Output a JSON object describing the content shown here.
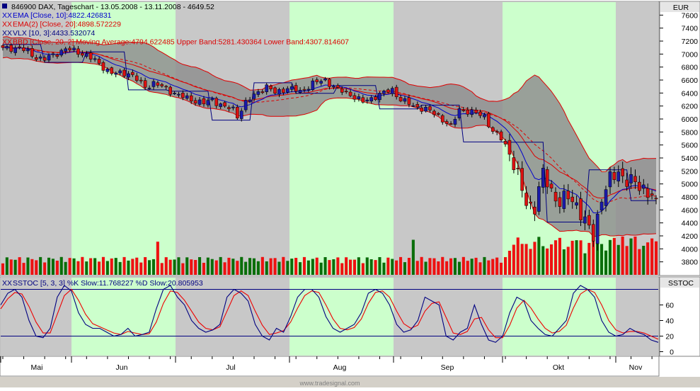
{
  "header": {
    "symbol_title": "846900 DAX, Tageschart - 13.05.2008 - 13.11.2008 - 4649.52",
    "currency": "EUR",
    "lower_panel_label": "SSTOC",
    "footer": "www.tradesignal.com"
  },
  "legend_upper": [
    {
      "text": "EMA [Close, 10]:4822.426831",
      "color": "#0000cc"
    },
    {
      "text": "EMA(2) [Close, 20]:4898.572229",
      "color": "#dd0000"
    },
    {
      "text": "VLX [10, 3]:4433.532074",
      "color": "#000080"
    },
    {
      "text": "BBD [Close, 20, 2] Moving Average:4794.622485 Upper Band:5281.430364 Lower Band:4307.814607",
      "color": "#dd0000"
    }
  ],
  "legend_lower": [
    {
      "text": "SSTOC [5, 3, 3] %K Slow:11.768227 %D Slow:20.805953",
      "color": "#000080"
    }
  ],
  "colors": {
    "up_candle": "#1a1aaa",
    "down_candle": "#dd1111",
    "volume_up": "#0a6e0a",
    "volume_down": "#ee1111",
    "band_fill": "#8f8f8f",
    "band_line": "#dd0000",
    "ema10": "#0000cc",
    "ema20": "#dd0000",
    "vlx": "#000080",
    "stoch_k": "#000080",
    "stoch_d": "#ee0000",
    "month_shade_green": "#ccffcc",
    "month_shade_grey": "#c8c8c8"
  },
  "chart_data": [
    {
      "type": "candlestick",
      "title": "846900 DAX, Tageschart - 13.05.2008 - 13.11.2008 - 4649.52",
      "ylabel": "EUR",
      "ylim": [
        3600,
        7800
      ],
      "yticks": [
        3800,
        4000,
        4200,
        4400,
        4600,
        4800,
        5000,
        5200,
        5400,
        5600,
        5800,
        6000,
        6200,
        6400,
        6600,
        6800,
        7000,
        7200,
        7400,
        7600
      ],
      "months": [
        "Mai",
        "Jun",
        "Jul",
        "Aug",
        "Sep",
        "Okt",
        "Nov"
      ],
      "anchors": [
        [
          0,
          7080
        ],
        [
          4,
          7100
        ],
        [
          8,
          6950
        ],
        [
          10,
          6920
        ],
        [
          15,
          7080
        ],
        [
          18,
          7030
        ],
        [
          20,
          6980
        ],
        [
          23,
          6850
        ],
        [
          26,
          6700
        ],
        [
          30,
          6710
        ],
        [
          34,
          6500
        ],
        [
          36,
          6550
        ],
        [
          39,
          6470
        ],
        [
          42,
          6360
        ],
        [
          45,
          6300
        ],
        [
          48,
          6240
        ],
        [
          50,
          6300
        ],
        [
          53,
          6180
        ],
        [
          55,
          6150
        ],
        [
          56,
          6050
        ],
        [
          58,
          6250
        ],
        [
          61,
          6420
        ],
        [
          63,
          6500
        ],
        [
          65,
          6400
        ],
        [
          68,
          6480
        ],
        [
          71,
          6420
        ],
        [
          74,
          6550
        ],
        [
          77,
          6600
        ],
        [
          80,
          6450
        ],
        [
          83,
          6380
        ],
        [
          86,
          6260
        ],
        [
          90,
          6380
        ],
        [
          93,
          6450
        ],
        [
          95,
          6300
        ],
        [
          98,
          6200
        ],
        [
          101,
          6150
        ],
        [
          104,
          6050
        ],
        [
          107,
          5880
        ],
        [
          109,
          6150
        ],
        [
          112,
          6100
        ],
        [
          115,
          6050
        ],
        [
          117,
          5800
        ],
        [
          119,
          5700
        ],
        [
          121,
          5500
        ],
        [
          123,
          5100
        ],
        [
          125,
          4700
        ],
        [
          127,
          4650
        ],
        [
          129,
          5150
        ],
        [
          131,
          4900
        ],
        [
          133,
          4700
        ],
        [
          135,
          4800
        ],
        [
          137,
          4700
        ],
        [
          139,
          4400
        ],
        [
          141,
          4200
        ],
        [
          143,
          4800
        ],
        [
          145,
          5050
        ],
        [
          147,
          5200
        ],
        [
          149,
          5050
        ],
        [
          151,
          5000
        ],
        [
          153,
          4950
        ],
        [
          155,
          4800
        ],
        [
          156,
          4650
        ]
      ],
      "volume_ylim": [
        0,
        100
      ],
      "xlabel": ""
    },
    {
      "type": "line",
      "title": "SSTOC [5, 3, 3] %K Slow:11.768227 %D Slow:20.805953",
      "ylim": [
        -5,
        95
      ],
      "yticks": [
        0,
        20,
        40,
        60
      ],
      "levels": [
        20,
        80
      ],
      "series": [
        {
          "name": "%K Slow",
          "values": [
            60,
            75,
            80,
            70,
            40,
            20,
            18,
            30,
            70,
            85,
            78,
            50,
            35,
            30,
            30,
            25,
            20,
            22,
            30,
            20,
            22,
            25,
            55,
            80,
            85,
            70,
            60,
            40,
            30,
            25,
            28,
            35,
            70,
            80,
            75,
            65,
            35,
            20,
            15,
            30,
            25,
            45,
            70,
            80,
            80,
            70,
            45,
            30,
            25,
            30,
            35,
            50,
            75,
            80,
            75,
            60,
            35,
            25,
            28,
            40,
            70,
            65,
            60,
            20,
            15,
            25,
            30,
            60,
            35,
            15,
            12,
            20,
            50,
            70,
            65,
            40,
            30,
            22,
            20,
            30,
            40,
            75,
            85,
            80,
            70,
            40,
            25,
            20,
            22,
            30,
            25,
            22,
            15,
            12
          ]
        },
        {
          "name": "%D Slow",
          "values": [
            55,
            68,
            76,
            74,
            58,
            38,
            24,
            24,
            48,
            72,
            80,
            66,
            48,
            36,
            32,
            28,
            24,
            22,
            26,
            24,
            22,
            23,
            38,
            62,
            78,
            76,
            66,
            52,
            38,
            30,
            28,
            32,
            52,
            72,
            78,
            72,
            52,
            34,
            22,
            24,
            27,
            38,
            56,
            72,
            78,
            76,
            60,
            42,
            30,
            28,
            31,
            42,
            62,
            76,
            78,
            70,
            52,
            36,
            30,
            34,
            52,
            62,
            64,
            44,
            24,
            22,
            26,
            42,
            44,
            28,
            18,
            18,
            34,
            56,
            66,
            56,
            42,
            30,
            24,
            26,
            34,
            56,
            74,
            80,
            76,
            60,
            40,
            28,
            24,
            26,
            26,
            24,
            20,
            16
          ]
        }
      ],
      "xlabel": ""
    }
  ]
}
